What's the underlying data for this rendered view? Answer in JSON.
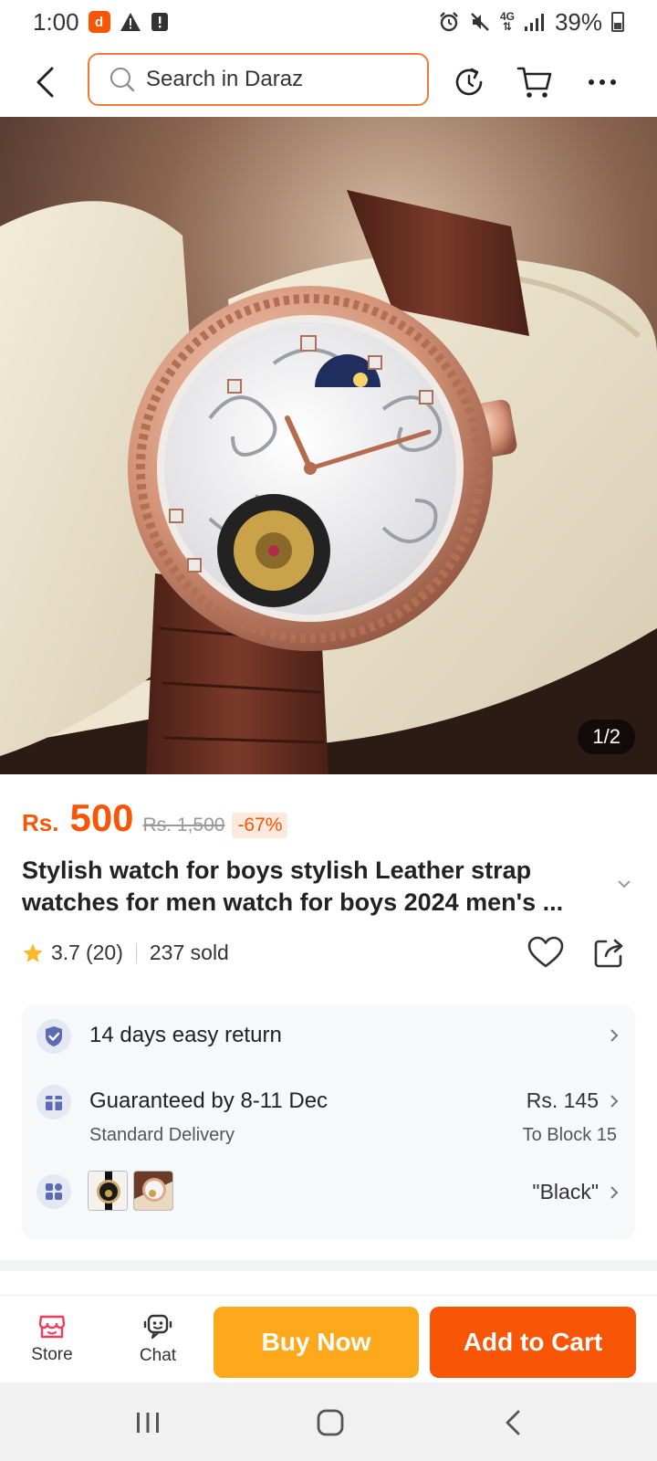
{
  "status_bar": {
    "time": "1:00",
    "network": "4G",
    "battery": "39%"
  },
  "header": {
    "search_placeholder": "Search in Daraz"
  },
  "gallery": {
    "counter": "1/2"
  },
  "product": {
    "currency": "Rs.",
    "price": "500",
    "original_price": "Rs. 1,500",
    "discount": "-67%",
    "title": "Stylish watch for boys stylish Leather strap watches for men watch for boys 2024 men's ...",
    "rating": "3.7",
    "rating_count": "(20)",
    "sold": "237 sold"
  },
  "info_card": {
    "return_policy": "14 days easy return",
    "delivery_guarantee": "Guaranteed by 8-11 Dec",
    "delivery_type": "Standard Delivery",
    "delivery_fee": "Rs. 145",
    "delivery_location": "To Block 15",
    "selected_variant": "\"Black\""
  },
  "action_bar": {
    "store_label": "Store",
    "chat_label": "Chat",
    "buy_now_label": "Buy Now",
    "add_to_cart_label": "Add to Cart"
  },
  "colors": {
    "brand_orange": "#f85606",
    "buy_now_yellow": "#fea81c",
    "rating_star": "#fbb829"
  }
}
